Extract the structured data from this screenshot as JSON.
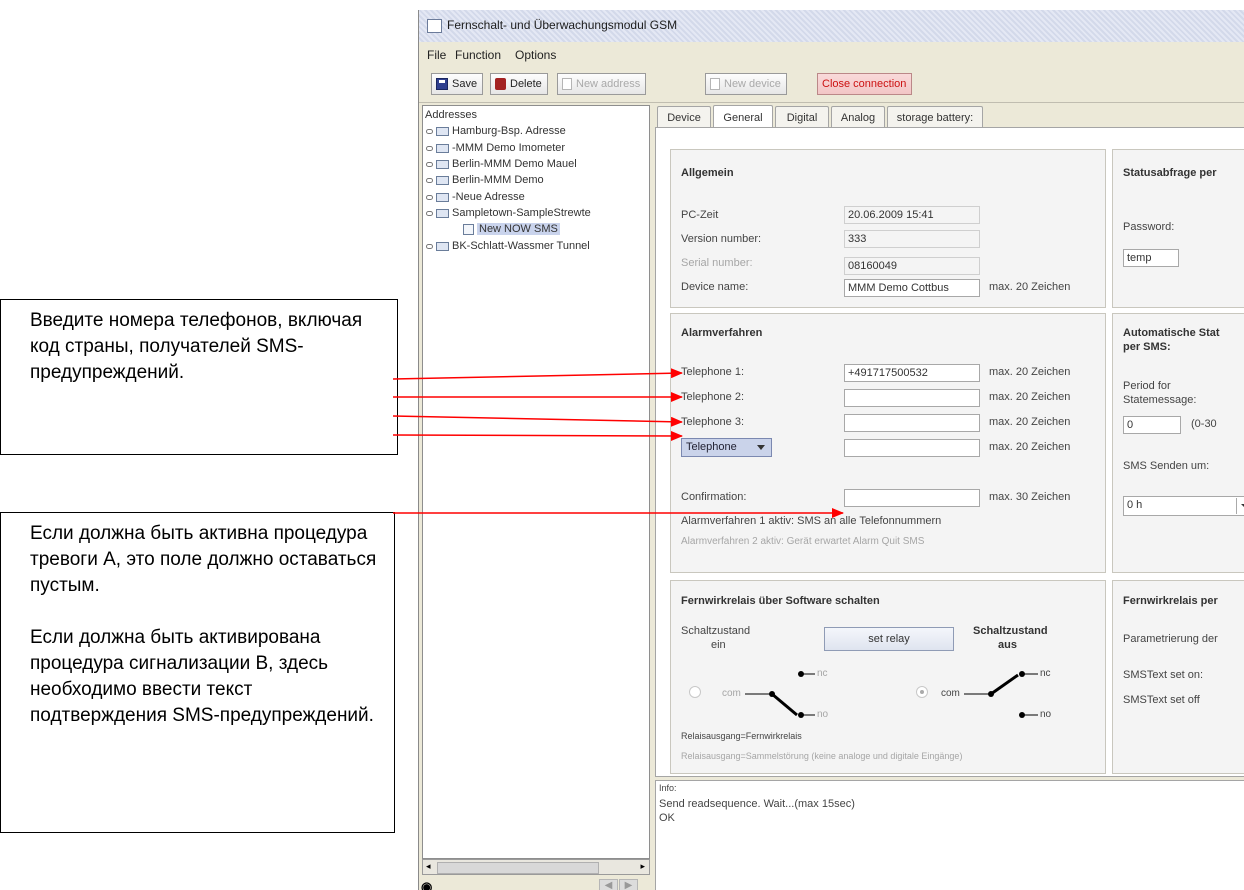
{
  "window": {
    "title": "Fernschalt- und Überwachungsmodul GSM"
  },
  "menu": [
    "File",
    "Function",
    "Options"
  ],
  "toolbar": {
    "save": "Save",
    "delete": "Delete",
    "new_address": "New address",
    "new_device": "New device",
    "close_connection": "Close connection"
  },
  "tree": {
    "title": "Addresses",
    "items": [
      "Hamburg-Bsp. Adresse",
      "-MMM Demo Imometer",
      "Berlin-MMM Demo Mauel",
      "Berlin-MMM Demo",
      "-Neue Adresse",
      "Sampletown-SampleStrewte",
      "New NOW SMS",
      "BK-Schlatt-Wassmer Tunnel"
    ]
  },
  "tabs": [
    "Device",
    "General",
    "Digital",
    "Analog",
    "storage battery:"
  ],
  "general": {
    "title": "Allgemein",
    "pc_time_label": "PC-Zeit",
    "pc_time_value": "20.06.2009 15:41",
    "version_label": "Version number:",
    "version_value": "333",
    "serial_label": "Serial number:",
    "serial_value": "08160049",
    "device_name_label": "Device name:",
    "device_name_value": "MMM Demo Cottbus",
    "device_name_hint": "max. 20 Zeichen"
  },
  "status": {
    "title": "Statusabfrage per",
    "password_label": "Password:",
    "password_value": "temp"
  },
  "alarm": {
    "title": "Alarmverfahren",
    "tel1_label": "Telephone 1:",
    "tel1_value": "+491717500532",
    "tel2_label": "Telephone 2:",
    "tel3_label": "Telephone 3:",
    "tel_combo": "Telephone",
    "hint20": "max. 20 Zeichen",
    "confirmation_label": "Confirmation:",
    "hint30": "max. 30 Zeichen",
    "note1": "Alarmverfahren 1 aktiv: SMS an alle Telefonnummern",
    "note2": "Alarmverfahren 2 aktiv: Gerät erwartet Alarm Quit SMS"
  },
  "auto": {
    "title": "Automatische Stat",
    "title2": "per SMS:",
    "period_label": "Period for",
    "period_label2": "Statemessage:",
    "period_value": "0",
    "period_range": "(0-30",
    "send_label": "SMS Senden um:",
    "send_value": "0 h"
  },
  "relay": {
    "title": "Fernwirkrelais über Software schalten",
    "on_label": "Schaltzustand",
    "on_label2": "ein",
    "off_label": "Schaltzustand",
    "off_label2": "aus",
    "button": "set relay",
    "nc": "nc",
    "no": "no",
    "com": "com",
    "note1": "Relaisausgang=Fernwirkrelais",
    "note2": "Relaisausgang=Sammelstörung (keine analoge und digitale Eingänge)"
  },
  "relay2": {
    "title": "Fernwirkrelais per",
    "param": "Parametrierung der",
    "on": "SMSText set on:",
    "off": "SMSText set off"
  },
  "info": {
    "label": "Info:",
    "line1": "Send readsequence. Wait...(max 15sec)",
    "line2": "OK"
  },
  "callouts": {
    "top": "Введите номера телефонов, включая код страны, получателей SMS-предупреждений.",
    "bottom_p1": "Если должна быть активна процедура тревоги А, это поле должно оставаться пустым.",
    "bottom_p2": "Если должна быть активирована процедура сигнализации В, здесь необходимо ввести текст подтверждения SMS-предупреждений."
  },
  "colors": {
    "arrow": "#ff0000",
    "combo": "#cad3ea",
    "close_button": "#cc1111"
  }
}
